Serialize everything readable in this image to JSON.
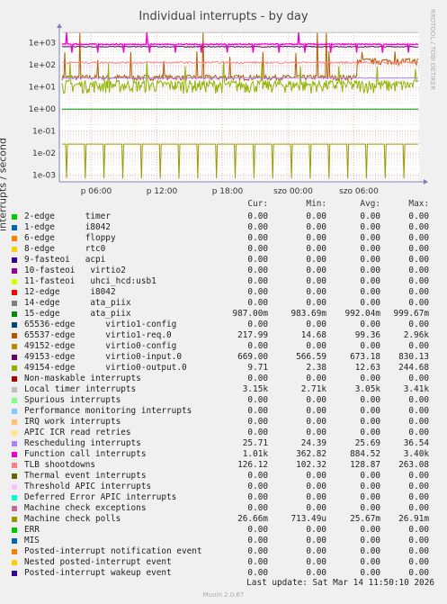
{
  "chart_data": {
    "type": "line",
    "title": "Individual interrupts - by day",
    "ylabel": "interrupts / second",
    "yscale": "log",
    "ylim": [
      "5e-4",
      "3e+3"
    ],
    "y_ticks": [
      "1e+03",
      "1e+02",
      "1e+01",
      "1e+00",
      "1e-01",
      "1e-02",
      "1e-03"
    ],
    "x_ticks": [
      "p 06:00",
      "p 12:00",
      "p 18:00",
      "szo 00:00",
      "szo 06:00"
    ],
    "grid": true,
    "columns": [
      "Cur:",
      "Min:",
      "Avg:",
      "Max:"
    ],
    "series": [
      {
        "name": "2-edge      timer",
        "color": "#00cc00",
        "cur": "0.00",
        "min": "0.00",
        "avg": "0.00",
        "max": "0.00"
      },
      {
        "name": "1-edge      i8042",
        "color": "#0066b3",
        "cur": "0.00",
        "min": "0.00",
        "avg": "0.00",
        "max": "0.00"
      },
      {
        "name": "6-edge      floppy",
        "color": "#ff8000",
        "cur": "0.00",
        "min": "0.00",
        "avg": "0.00",
        "max": "0.00"
      },
      {
        "name": "8-edge      rtc0",
        "color": "#ffcc00",
        "cur": "0.00",
        "min": "0.00",
        "avg": "0.00",
        "max": "0.00"
      },
      {
        "name": "9-fasteoi   acpi",
        "color": "#330099",
        "cur": "0.00",
        "min": "0.00",
        "avg": "0.00",
        "max": "0.00"
      },
      {
        "name": "10-fasteoi   virtio2",
        "color": "#990099",
        "cur": "0.00",
        "min": "0.00",
        "avg": "0.00",
        "max": "0.00"
      },
      {
        "name": "11-fasteoi   uhci_hcd:usb1",
        "color": "#ccff00",
        "cur": "0.00",
        "min": "0.00",
        "avg": "0.00",
        "max": "0.00"
      },
      {
        "name": "12-edge      i8042",
        "color": "#ff0000",
        "cur": "0.00",
        "min": "0.00",
        "avg": "0.00",
        "max": "0.00"
      },
      {
        "name": "14-edge      ata_piix",
        "color": "#808080",
        "cur": "0.00",
        "min": "0.00",
        "avg": "0.00",
        "max": "0.00"
      },
      {
        "name": "15-edge      ata_piix",
        "color": "#008f00",
        "cur": "987.00m",
        "min": "983.69m",
        "avg": "992.04m",
        "max": "999.67m"
      },
      {
        "name": "65536-edge      virtio1-config",
        "color": "#00487d",
        "cur": "0.00",
        "min": "0.00",
        "avg": "0.00",
        "max": "0.00"
      },
      {
        "name": "65537-edge      virtio1-req.0",
        "color": "#b35a00",
        "cur": "217.99",
        "min": "14.68",
        "avg": "99.36",
        "max": "2.96k"
      },
      {
        "name": "49152-edge      virtio0-config",
        "color": "#b38f00",
        "cur": "0.00",
        "min": "0.00",
        "avg": "0.00",
        "max": "0.00"
      },
      {
        "name": "49153-edge      virtio0-input.0",
        "color": "#6b006b",
        "cur": "669.00",
        "min": "566.59",
        "avg": "673.18",
        "max": "830.13"
      },
      {
        "name": "49154-edge      virtio0-output.0",
        "color": "#8fb300",
        "cur": "9.71",
        "min": "2.38",
        "avg": "12.63",
        "max": "244.68"
      },
      {
        "name": "Non-maskable interrupts",
        "color": "#b30000",
        "cur": "0.00",
        "min": "0.00",
        "avg": "0.00",
        "max": "0.00"
      },
      {
        "name": "Local timer interrupts",
        "color": "#bebebe",
        "cur": "3.15k",
        "min": "2.71k",
        "avg": "3.05k",
        "max": "3.41k"
      },
      {
        "name": "Spurious interrupts",
        "color": "#80ff80",
        "cur": "0.00",
        "min": "0.00",
        "avg": "0.00",
        "max": "0.00"
      },
      {
        "name": "Performance monitoring interrupts",
        "color": "#80c9ff",
        "cur": "0.00",
        "min": "0.00",
        "avg": "0.00",
        "max": "0.00"
      },
      {
        "name": "IRQ work interrupts",
        "color": "#ffc080",
        "cur": "0.00",
        "min": "0.00",
        "avg": "0.00",
        "max": "0.00"
      },
      {
        "name": "APIC ICR read retries",
        "color": "#ffe680",
        "cur": "0.00",
        "min": "0.00",
        "avg": "0.00",
        "max": "0.00"
      },
      {
        "name": "Rescheduling interrupts",
        "color": "#aa80ff",
        "cur": "25.71",
        "min": "24.39",
        "avg": "25.69",
        "max": "36.54"
      },
      {
        "name": "Function call interrupts",
        "color": "#ee00cc",
        "cur": "1.01k",
        "min": "362.82",
        "avg": "884.52",
        "max": "3.40k"
      },
      {
        "name": "TLB shootdowns",
        "color": "#ff8080",
        "cur": "126.12",
        "min": "102.32",
        "avg": "128.87",
        "max": "263.08"
      },
      {
        "name": "Thermal event interrupts",
        "color": "#666600",
        "cur": "0.00",
        "min": "0.00",
        "avg": "0.00",
        "max": "0.00"
      },
      {
        "name": "Threshold APIC interrupts",
        "color": "#ffbfff",
        "cur": "0.00",
        "min": "0.00",
        "avg": "0.00",
        "max": "0.00"
      },
      {
        "name": "Deferred Error APIC interrupts",
        "color": "#00ffcc",
        "cur": "0.00",
        "min": "0.00",
        "avg": "0.00",
        "max": "0.00"
      },
      {
        "name": "Machine check exceptions",
        "color": "#cc6699",
        "cur": "0.00",
        "min": "0.00",
        "avg": "0.00",
        "max": "0.00"
      },
      {
        "name": "Machine check polls",
        "color": "#999900",
        "cur": "26.66m",
        "min": "713.49u",
        "avg": "25.67m",
        "max": "26.91m"
      },
      {
        "name": "ERR",
        "color": "#00cc00",
        "cur": "0.00",
        "min": "0.00",
        "avg": "0.00",
        "max": "0.00"
      },
      {
        "name": "MIS",
        "color": "#0066b3",
        "cur": "0.00",
        "min": "0.00",
        "avg": "0.00",
        "max": "0.00"
      },
      {
        "name": "Posted-interrupt notification event",
        "color": "#ff8000",
        "cur": "0.00",
        "min": "0.00",
        "avg": "0.00",
        "max": "0.00"
      },
      {
        "name": "Nested posted-interrupt event",
        "color": "#ffcc00",
        "cur": "0.00",
        "min": "0.00",
        "avg": "0.00",
        "max": "0.00"
      },
      {
        "name": "Posted-interrupt wakeup event",
        "color": "#330099",
        "cur": "0.00",
        "min": "0.00",
        "avg": "0.00",
        "max": "0.00"
      }
    ]
  },
  "side_label": "RRDTOOL / TOBI OETIKER",
  "footer": "Last update: Sat Mar 14 11:50:10 2026",
  "munin": "Munin 2.0.67"
}
